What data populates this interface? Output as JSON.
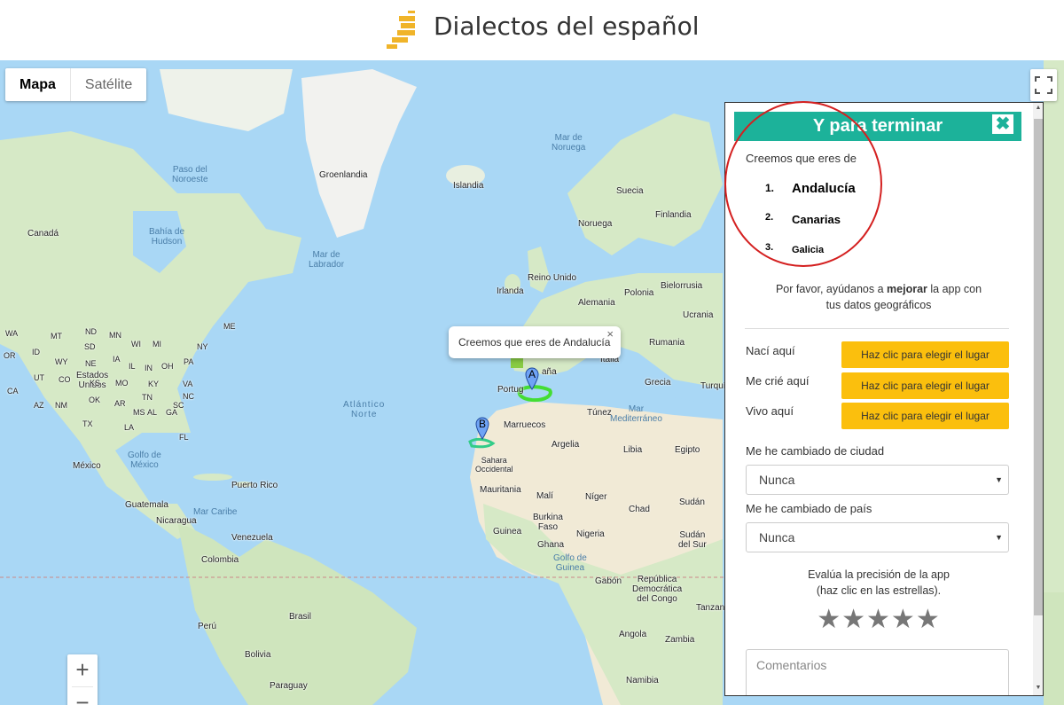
{
  "header": {
    "title": "Dialectos del español"
  },
  "map": {
    "type_buttons": {
      "map": "Mapa",
      "satellite": "Satélite"
    },
    "fullscreen_icon": "fullscreen-icon",
    "zoom": {
      "in": "+",
      "out": "−"
    },
    "infowindow": {
      "text": "Creemos que eres de Andalucía",
      "close": "×"
    },
    "markers": [
      "A",
      "B"
    ],
    "labels": {
      "groenlandia": "Groenlandia",
      "islandia": "Islandia",
      "mar_noruega": "Mar de\nNoruega",
      "paso_noroeste": "Paso del\nNoroeste",
      "canada": "Canadá",
      "bahia_hudson": "Bahía de\nHudson",
      "mar_labrador": "Mar de\nLabrador",
      "suecia": "Suecia",
      "finlandia": "Finlandia",
      "noruega": "Noruega",
      "reino_unido": "Reino Unido",
      "irlanda": "Irlanda",
      "polonia": "Polonia",
      "bielorrusia": "Bielorrusia",
      "alemania": "Alemania",
      "ucrania": "Ucrania",
      "rumania": "Rumania",
      "italia": "Italia",
      "grecia": "Grecia",
      "turquia": "Turquí",
      "espana": "aña",
      "portugal": "Portug",
      "estados_unidos": "Estados\nUnidos",
      "atlantico_norte": "Atlántico\nNorte",
      "tunez": "Túnez",
      "mar_mediterraneo": "Mar\nMediterráneo",
      "marruecos": "Marruecos",
      "argelia": "Argelia",
      "libia": "Libia",
      "egipto": "Egipto",
      "sahara_occidental": "Sahara\nOccidental",
      "mexico": "México",
      "golfo_mexico": "Golfo de\nMéxico",
      "mauritania": "Mauritania",
      "mali": "Malí",
      "niger": "Níger",
      "chad": "Chad",
      "sudan": "Sudán",
      "puerto_rico": "Puerto Rico",
      "guatemala": "Guatemala",
      "mar_caribe": "Mar Caribe",
      "nicaragua": "Nicaragua",
      "burkina_faso": "Burkina\nFaso",
      "guinea": "Guinea",
      "ghana": "Ghana",
      "nigeria": "Nigeria",
      "sudan_sur": "Sudán\ndel Sur",
      "venezuela": "Venezuela",
      "colombia": "Colombia",
      "golfo_guinea": "Golfo de\nGuinea",
      "gabon": "Gabón",
      "rdc": "República\nDemocrática\ndel Congo",
      "brasil": "Brasil",
      "peru": "Perú",
      "bolivia": "Bolivia",
      "angola": "Angola",
      "zambia": "Zambia",
      "tanzania": "Tanzan",
      "namibia": "Namibia",
      "paraguay": "Paraguay",
      "wa": "WA",
      "mt": "MT",
      "or": "OR",
      "id": "ID",
      "sd": "SD",
      "wy": "WY",
      "ne": "NE",
      "ca": "CA",
      "ut": "UT",
      "co": "CO",
      "ks": "KS",
      "mo": "MO",
      "az": "AZ",
      "nm": "NM",
      "ok": "OK",
      "tx": "TX",
      "ar": "AR",
      "ms": "MS",
      "al": "AL",
      "ga": "GA",
      "la": "LA",
      "fl": "FL",
      "il": "IL",
      "in": "IN",
      "oh": "OH",
      "ky": "KY",
      "tn": "TN",
      "va": "VA",
      "nc": "NC",
      "sc": "SC",
      "mi": "MI",
      "wi": "WI",
      "pa": "PA",
      "ny": "NY",
      "me": "ME",
      "mn": "MN",
      "ia": "IA",
      "nd": "ND"
    }
  },
  "panel": {
    "title": "Y para terminar",
    "close": "✖",
    "intro": "Creemos que eres de",
    "ranking": [
      {
        "num": "1.",
        "name": "Andalucía"
      },
      {
        "num": "2.",
        "name": "Canarias"
      },
      {
        "num": "3.",
        "name": "Galicia"
      }
    ],
    "help_pre": "Por favor, ayúdanos a ",
    "help_bold": "mejorar",
    "help_post": " la app con",
    "help_line2": "tus datos geográficos",
    "places": [
      {
        "label": "Nací aquí",
        "button": "Haz clic para elegir el lugar"
      },
      {
        "label": "Me crié aquí",
        "button": "Haz clic para elegir el lugar"
      },
      {
        "label": "Vivo aquí",
        "button": "Haz clic para elegir el lugar"
      }
    ],
    "city_change": {
      "label": "Me he cambiado de ciudad",
      "value": "Nunca"
    },
    "country_change": {
      "label": "Me he cambiado de país",
      "value": "Nunca"
    },
    "rate_line1": "Evalúa la precisión de la app",
    "rate_line2": "(haz clic en las estrellas).",
    "stars": "★★★★★",
    "rating": 0,
    "comments_placeholder": "Comentarios"
  },
  "colors": {
    "accent": "#1cb29a",
    "button": "#fbbf0d",
    "highlight": "#d42020",
    "sea": "#a9d7f5",
    "land": "#d6e9c6"
  }
}
